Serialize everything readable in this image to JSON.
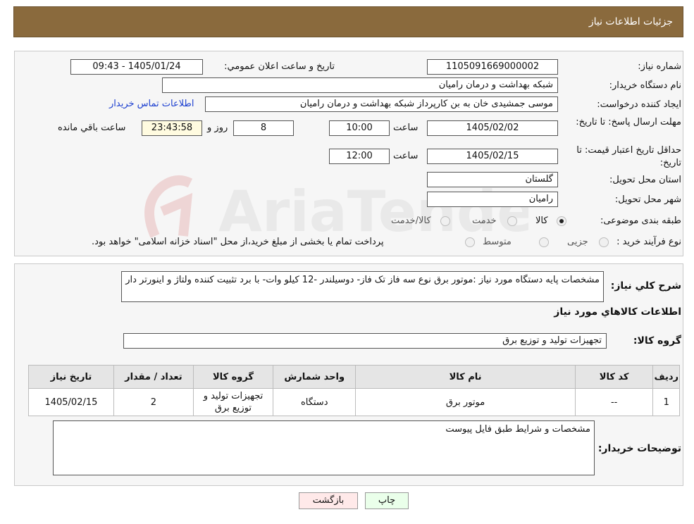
{
  "header": {
    "title": "جزئیات اطلاعات نیاز"
  },
  "details": {
    "need_number": {
      "label": "شماره نیاز:",
      "value": "1105091669000002"
    },
    "announce_datetime": {
      "label": "تاریخ و ساعت اعلان عمومي:",
      "value": "1405/01/24 - 09:43"
    },
    "buyer_org": {
      "label": "نام دستگاه خريدار:",
      "value": "شبکه بهداشت و درمان رامیان"
    },
    "requester": {
      "label": "ايجاد کننده درخواست:",
      "value": "موسی جمشیدی خان به بن کارپرداز شبکه بهداشت و درمان رامیان",
      "contact_link": "اطلاعات تماس خريدار"
    },
    "deadline": {
      "label": "مهلت ارسال پاسخ: تا تاريخ:",
      "date": "1405/02/02",
      "time_label": "ساعت",
      "time": "10:00",
      "days": "8",
      "days_label": "روز و",
      "remaining": "23:43:58",
      "remaining_label": "ساعت باقي مانده"
    },
    "price_validity": {
      "label": "حداقل تاريخ اعتبار قيمت: تا تاريخ:",
      "date": "1405/02/15",
      "time_label": "ساعت",
      "time": "12:00"
    },
    "province": {
      "label": "استان محل تحويل:",
      "value": "گلستان"
    },
    "city": {
      "label": "شهر محل تحويل:",
      "value": "رامیان"
    },
    "category": {
      "label": "طبقه بندی موضوعی:",
      "options": [
        "کالا",
        "خدمت",
        "کالا/خدمت"
      ],
      "selected": "کالا"
    },
    "process_type": {
      "label": "نوع فرآيند خريد :",
      "options": [
        "جزیی",
        "متوسط"
      ],
      "note": "پرداخت تمام يا بخشی از مبلغ خريد،از محل \"اسناد خزانه اسلامی\" خواهد بود."
    }
  },
  "description": {
    "label": "شرح کلي نياز:",
    "value": "مشخصات پایه دستگاه مورد نیاز :موتور برق نوع سه فاز تک فاز- دوسیلندر -12 کیلو وات- با برد تثبیت کننده ولتاژ و اینورتر دار"
  },
  "items_section": {
    "title": "اطلاعات کالاهاي مورد نياز",
    "group_label": "گروه کالا:",
    "group_value": "تجهیزات تولید و توزیع برق",
    "columns": [
      "رديف",
      "کد کالا",
      "نام کالا",
      "واحد شمارش",
      "گروه کالا",
      "تعداد / مقدار",
      "تاريخ نياز"
    ],
    "rows": [
      [
        "1",
        "--",
        "موتور برق",
        "دستگاه",
        "تجهیزات تولید و توزیع برق",
        "2",
        "1405/02/15"
      ]
    ]
  },
  "buyer_notes": {
    "label": "توضيحات خريدار:",
    "value": "مشخصات و شرایط طبق فایل پیوست"
  },
  "buttons": {
    "print": "چاپ",
    "back": "بازگشت"
  },
  "watermark": {
    "text": "AriaTender.neT"
  }
}
